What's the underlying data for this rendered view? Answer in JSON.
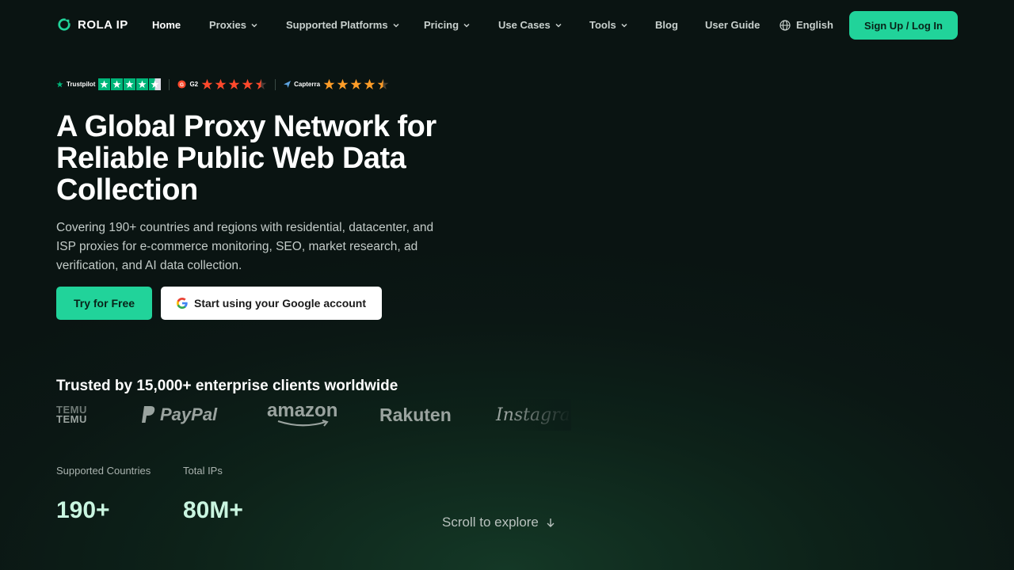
{
  "brand": {
    "name": "ROLA IP",
    "logo_icon": "refresh-ring-icon",
    "accent": "#21d39a"
  },
  "nav": {
    "items": [
      {
        "label": "Home",
        "has_dropdown": false,
        "active": true
      },
      {
        "label": "Proxies",
        "has_dropdown": true
      },
      {
        "label": "Supported Platforms",
        "has_dropdown": true
      },
      {
        "label": "Pricing",
        "has_dropdown": true
      },
      {
        "label": "Use Cases",
        "has_dropdown": true
      },
      {
        "label": "Tools",
        "has_dropdown": true
      },
      {
        "label": "Blog",
        "has_dropdown": false
      },
      {
        "label": "User Guide",
        "has_dropdown": false
      }
    ],
    "language": {
      "label": "English",
      "icon": "globe-icon"
    },
    "signup_label": "Sign Up / Log In"
  },
  "ratings": [
    {
      "site": "Trustpilot",
      "stars": 4.5,
      "color": "#00b67a"
    },
    {
      "site": "G2",
      "stars": 4.5,
      "color": "#ff492c"
    },
    {
      "site": "Capterra",
      "stars": 4.5,
      "color": "#ff9d28"
    }
  ],
  "hero": {
    "title_lines": [
      "A Global Proxy Network for",
      "Reliable Public Web Data",
      "Collection"
    ],
    "subtitle": "Covering 190+ countries and regions with residential, datacenter, and ISP proxies for e-commerce monitoring, SEO, market research, ad verification, and AI data collection.",
    "primary_cta": "Try for Free",
    "google_cta": "Start using your Google account"
  },
  "trusted": {
    "heading": "Trusted by 15,000+ enterprise clients worldwide",
    "logos": [
      {
        "name": "Temu",
        "text_top": "TEMU",
        "text": "TEMU"
      },
      {
        "name": "PayPal",
        "text": "PayPal"
      },
      {
        "name": "Amazon",
        "text": "amazon"
      },
      {
        "name": "Rakuten",
        "text": "Rakuten"
      },
      {
        "name": "Instagram",
        "text": "Instagram"
      }
    ]
  },
  "stats": [
    {
      "label": "Supported Countries",
      "value": "190+"
    },
    {
      "label": "Total IPs",
      "value": "80M+"
    }
  ],
  "scroll_hint": "Scroll to explore"
}
